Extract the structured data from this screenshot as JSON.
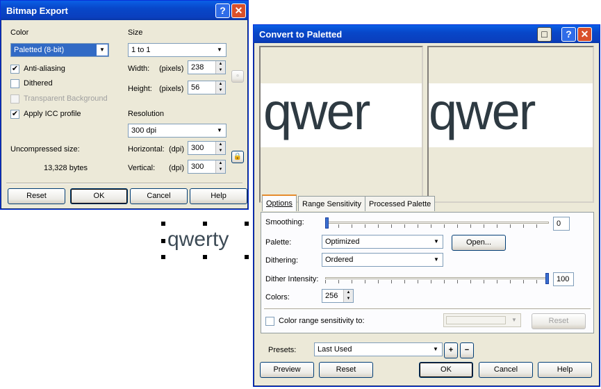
{
  "bitmap_export": {
    "title": "Bitmap Export",
    "color_label": "Color",
    "color_value": "Paletted (8-bit)",
    "anti_aliasing": "Anti-aliasing",
    "dithered": "Dithered",
    "transparent_bg": "Transparent Background",
    "apply_icc": "Apply ICC profile",
    "size_label": "Size",
    "size_value": "1 to 1",
    "width_label": "Width:",
    "width_unit": "(pixels)",
    "width_value": "238",
    "height_label": "Height:",
    "height_unit": "(pixels)",
    "height_value": "56",
    "resolution_label": "Resolution",
    "resolution_value": "300 dpi",
    "uncompressed_label": "Uncompressed size:",
    "uncompressed_value": "13,328 bytes",
    "horizontal_label": "Horizontal:",
    "horizontal_unit": "(dpi)",
    "horizontal_value": "300",
    "vertical_label": "Vertical:",
    "vertical_unit": "(dpi)",
    "vertical_value": "300",
    "reset": "Reset",
    "ok": "OK",
    "cancel": "Cancel",
    "help": "Help"
  },
  "canvas_text": "qwerty",
  "convert": {
    "title": "Convert to Paletted",
    "preview_before": "qwer",
    "preview_after": "qwer",
    "tabs": [
      "Options",
      "Range Sensitivity",
      "Processed Palette"
    ],
    "smoothing_label": "Smoothing:",
    "smoothing_value": "0",
    "palette_label": "Palette:",
    "palette_value": "Optimized",
    "open_button": "Open...",
    "dithering_label": "Dithering:",
    "dithering_value": "Ordered",
    "dither_intensity_label": "Dither Intensity:",
    "dither_intensity_value": "100",
    "colors_label": "Colors:",
    "colors_value": "256",
    "range_sensitivity_label": "Color range sensitivity to:",
    "range_reset": "Reset",
    "presets_label": "Presets:",
    "presets_value": "Last Used",
    "add_preset": "+",
    "remove_preset": "−",
    "preview": "Preview",
    "reset": "Reset",
    "ok": "OK",
    "cancel": "Cancel",
    "help": "Help"
  },
  "colors": {
    "title_blue": "#0a4fd6",
    "dialog_bg": "#ece9d8",
    "close_red": "#d9502b",
    "slider_thumb": "#3a6fd0"
  }
}
